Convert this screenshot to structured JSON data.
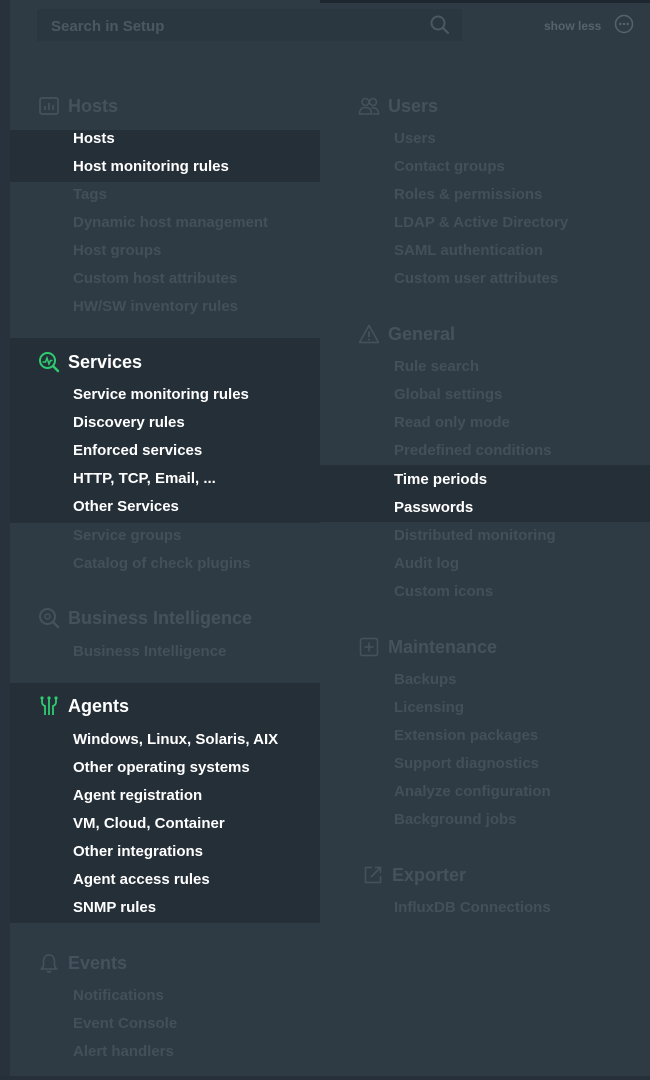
{
  "search": {
    "placeholder": "Search in Setup"
  },
  "show_less": {
    "label": "show less"
  },
  "left": {
    "hosts": {
      "title": "Hosts",
      "items": [
        {
          "label": "Hosts",
          "bright": true
        },
        {
          "label": "Host monitoring rules",
          "bright": true
        },
        {
          "label": "Tags",
          "bright": false
        },
        {
          "label": "Dynamic host management",
          "bright": false
        },
        {
          "label": "Host groups",
          "bright": false
        },
        {
          "label": "Custom host attributes",
          "bright": false
        },
        {
          "label": "HW/SW inventory rules",
          "bright": false
        }
      ]
    },
    "services": {
      "title": "Services",
      "items": [
        {
          "label": "Service monitoring rules",
          "bright": true
        },
        {
          "label": "Discovery rules",
          "bright": true
        },
        {
          "label": "Enforced services",
          "bright": true
        },
        {
          "label": "HTTP, TCP, Email, ...",
          "bright": true
        },
        {
          "label": "Other Services",
          "bright": true
        },
        {
          "label": "Service groups",
          "bright": false
        },
        {
          "label": "Catalog of check plugins",
          "bright": false
        }
      ]
    },
    "bi": {
      "title": "Business Intelligence",
      "items": [
        {
          "label": "Business Intelligence",
          "bright": false
        }
      ]
    },
    "agents": {
      "title": "Agents",
      "items": [
        {
          "label": "Windows, Linux, Solaris, AIX",
          "bright": true
        },
        {
          "label": "Other operating systems",
          "bright": true
        },
        {
          "label": "Agent registration",
          "bright": true
        },
        {
          "label": "VM, Cloud, Container",
          "bright": true
        },
        {
          "label": "Other integrations",
          "bright": true
        },
        {
          "label": "Agent access rules",
          "bright": true
        },
        {
          "label": "SNMP rules",
          "bright": true
        }
      ]
    },
    "events": {
      "title": "Events",
      "items": [
        {
          "label": "Notifications",
          "bright": false
        },
        {
          "label": "Event Console",
          "bright": false
        },
        {
          "label": "Alert handlers",
          "bright": false
        }
      ]
    }
  },
  "right": {
    "users": {
      "title": "Users",
      "items": [
        {
          "label": "Users",
          "bright": false
        },
        {
          "label": "Contact groups",
          "bright": false
        },
        {
          "label": "Roles & permissions",
          "bright": false
        },
        {
          "label": "LDAP & Active Directory",
          "bright": false
        },
        {
          "label": "SAML authentication",
          "bright": false
        },
        {
          "label": "Custom user attributes",
          "bright": false
        }
      ]
    },
    "general": {
      "title": "General",
      "items": [
        {
          "label": "Rule search",
          "bright": false
        },
        {
          "label": "Global settings",
          "bright": false
        },
        {
          "label": "Read only mode",
          "bright": false
        },
        {
          "label": "Predefined conditions",
          "bright": false
        },
        {
          "label": "Time periods",
          "bright": true
        },
        {
          "label": "Passwords",
          "bright": true
        },
        {
          "label": "Distributed monitoring",
          "bright": false
        },
        {
          "label": "Audit log",
          "bright": false
        },
        {
          "label": "Custom icons",
          "bright": false
        }
      ]
    },
    "maintenance": {
      "title": "Maintenance",
      "items": [
        {
          "label": "Backups",
          "bright": false
        },
        {
          "label": "Licensing",
          "bright": false
        },
        {
          "label": "Extension packages",
          "bright": false
        },
        {
          "label": "Support diagnostics",
          "bright": false
        },
        {
          "label": "Analyze configuration",
          "bright": false
        },
        {
          "label": "Background jobs",
          "bright": false
        }
      ]
    },
    "exporter": {
      "title": "Exporter",
      "items": [
        {
          "label": "InfluxDB Connections",
          "bright": false
        }
      ]
    }
  },
  "icons": {
    "hosts": "hosts-icon",
    "services": "services-icon",
    "bi": "business-intelligence-icon",
    "agents": "agents-icon",
    "events": "bell-icon",
    "users": "users-icon",
    "general": "warning-triangle-icon",
    "maintenance": "plus-box-icon",
    "exporter": "export-icon"
  },
  "colors": {
    "accent": "#2ecc71",
    "highlight_bg": "#252f38",
    "page_bg": "#2e3a44"
  }
}
